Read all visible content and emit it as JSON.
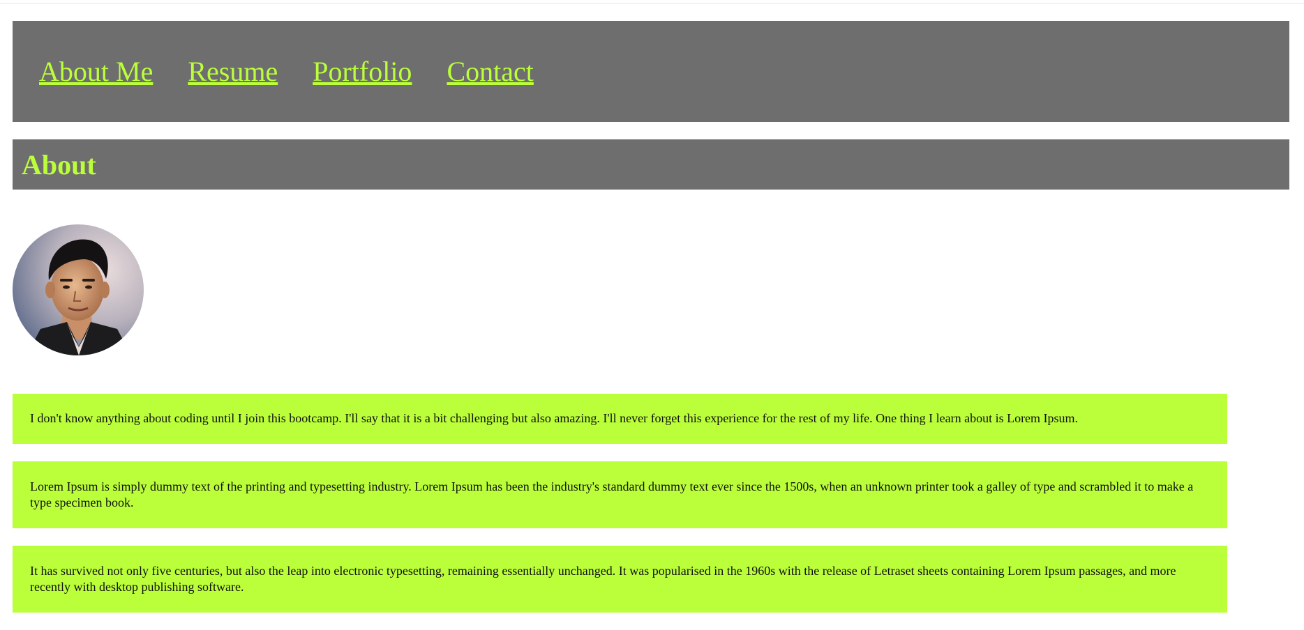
{
  "nav": {
    "items": [
      {
        "label": "About Me"
      },
      {
        "label": "Resume"
      },
      {
        "label": "Portfolio"
      },
      {
        "label": "Contact"
      }
    ]
  },
  "section": {
    "title": "About"
  },
  "profile": {
    "avatar_icon": "profile-photo"
  },
  "paragraphs": [
    {
      "text": "I don't know anything about coding until I join this bootcamp. I'll say that it is a bit challenging but also amazing. I'll never forget this experience for the rest of my life. One thing I learn about is Lorem Ipsum."
    },
    {
      "text": "Lorem Ipsum is simply dummy text of the printing and typesetting industry. Lorem Ipsum has been the industry's standard dummy text ever since the 1500s, when an unknown printer took a galley of type and scrambled it to make a type specimen book."
    },
    {
      "text": "It has survived not only five centuries, but also the leap into electronic typesetting, remaining essentially unchanged. It was popularised in the 1960s with the release of Letraset sheets containing Lorem Ipsum passages, and more recently with desktop publishing software."
    }
  ],
  "colors": {
    "header_bg": "#6e6e6e",
    "accent": "#bbff3a",
    "text": "#111111"
  }
}
